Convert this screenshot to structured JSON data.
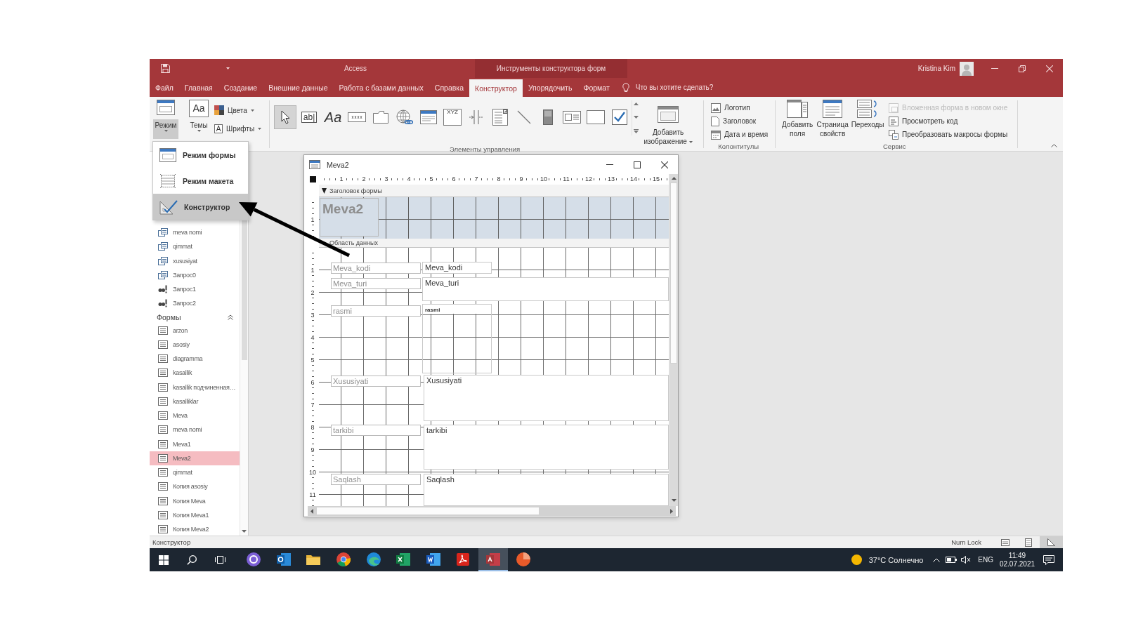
{
  "title_bar": {
    "app_name": "Access",
    "context_title": "Инструменты конструктора форм",
    "user_name": "Kristina Kim"
  },
  "ribbon_tabs": [
    {
      "label": "Файл",
      "selected": false
    },
    {
      "label": "Главная",
      "selected": false
    },
    {
      "label": "Создание",
      "selected": false
    },
    {
      "label": "Внешние данные",
      "selected": false
    },
    {
      "label": "Работа с базами данных",
      "selected": false
    },
    {
      "label": "Справка",
      "selected": false
    },
    {
      "label": "Конструктор",
      "selected": true
    },
    {
      "label": "Упорядочить",
      "selected": false
    },
    {
      "label": "Формат",
      "selected": false
    }
  ],
  "tell_me": {
    "placeholder": "Что вы хотите сделать?"
  },
  "ribbon": {
    "view_button": {
      "label": "Режим",
      "pressed": true
    },
    "themes": {
      "label": "Темы",
      "glyph": "Aa"
    },
    "colors": {
      "label": "Цвета"
    },
    "fonts": {
      "label": "Шрифты",
      "glyph": "A"
    },
    "controls": {
      "label": "Элементы управления",
      "tools": [
        {
          "kind": "pointer",
          "selected": true
        },
        {
          "kind": "text_box",
          "glyph": "ab|",
          "selected": false
        },
        {
          "kind": "label",
          "glyph": "Aa",
          "selected": false
        },
        {
          "kind": "button",
          "selected": false
        },
        {
          "kind": "tab_control",
          "selected": false
        },
        {
          "kind": "hyperlink",
          "selected": false
        },
        {
          "kind": "web_browser",
          "selected": false
        },
        {
          "kind": "option_group",
          "glyph": "XYZ",
          "selected": false
        },
        {
          "kind": "page_break",
          "selected": false
        },
        {
          "kind": "combo_box",
          "selected": false
        },
        {
          "kind": "line",
          "selected": false
        },
        {
          "kind": "toggle",
          "selected": false
        },
        {
          "kind": "list_box",
          "selected": false
        },
        {
          "kind": "rectangle",
          "selected": false
        },
        {
          "kind": "check_box",
          "selected": false
        }
      ],
      "insert_image": "Добавить изображение"
    },
    "header_footer": {
      "label": "Колонтитулы",
      "items": [
        {
          "kind": "logo",
          "label": "Логотип"
        },
        {
          "kind": "title",
          "label": "Заголовок"
        },
        {
          "kind": "date_time",
          "label": "Дата и время"
        }
      ]
    },
    "tools": {
      "label": "Сервис",
      "buttons": [
        {
          "kind": "add_fields",
          "label": "Добавить поля"
        },
        {
          "kind": "property_sheet",
          "label": "Страница свойств"
        },
        {
          "kind": "tab_order",
          "label": "Переходы"
        }
      ],
      "commands": [
        {
          "kind": "subform",
          "label": "Вложенная форма в новом окне",
          "disabled": true
        },
        {
          "kind": "view_code",
          "label": "Просмотреть код",
          "disabled": false
        },
        {
          "kind": "convert_macros",
          "label": "Преобразовать макросы формы",
          "disabled": false
        }
      ]
    }
  },
  "view_menu": {
    "items": [
      {
        "kind": "form_view",
        "label": "Режим формы",
        "selected": false
      },
      {
        "kind": "layout_view",
        "label": "Режим макета",
        "selected": false
      },
      {
        "kind": "design_view",
        "label": "Конструктор",
        "selected": true
      }
    ]
  },
  "navigation": {
    "queries": [
      {
        "kind": "select",
        "label": "meva nomi",
        "selected": false
      },
      {
        "kind": "select",
        "label": "qimmat",
        "selected": false
      },
      {
        "kind": "select",
        "label": "xususiyat",
        "selected": false
      },
      {
        "kind": "select",
        "label": "Запрос0",
        "selected": false
      },
      {
        "kind": "action",
        "label": "Запрос1",
        "selected": false
      },
      {
        "kind": "action",
        "label": "Запрос2",
        "selected": false
      }
    ],
    "forms_group": {
      "title": "Формы",
      "expanded": true,
      "items": [
        {
          "label": "arzon",
          "selected": false
        },
        {
          "label": "asosiy",
          "selected": false
        },
        {
          "label": "diagramma",
          "selected": false
        },
        {
          "label": "kasallik",
          "selected": false
        },
        {
          "label": "kasallik подчиненная…",
          "selected": false
        },
        {
          "label": "kasalliklar",
          "selected": false
        },
        {
          "label": "Meva",
          "selected": false
        },
        {
          "label": "meva nomi",
          "selected": false
        },
        {
          "label": "Meva1",
          "selected": false
        },
        {
          "label": "Meva2",
          "selected": true
        },
        {
          "label": "qimmat",
          "selected": false
        },
        {
          "label": "Копия asosiy",
          "selected": false
        },
        {
          "label": "Копия Meva",
          "selected": false
        },
        {
          "label": "Копия Meva1",
          "selected": false
        },
        {
          "label": "Копия Meva2",
          "selected": false
        }
      ]
    }
  },
  "form_window": {
    "title": "Meva2",
    "ruler": [
      "1",
      "2",
      "3",
      "4",
      "5",
      "6",
      "7",
      "8",
      "9",
      "10",
      "11",
      "12",
      "13",
      "14",
      "15"
    ],
    "header_band": "Заголовок формы",
    "header_ruler": [
      "1"
    ],
    "header_title": "Meva2",
    "detail_band": "Область данных",
    "detail_ruler": [
      "1",
      "2",
      "3",
      "4",
      "5",
      "6",
      "7",
      "8",
      "9",
      "10",
      "11"
    ],
    "fields": [
      {
        "kind": "text",
        "label": "Meva_kodi",
        "control": "Meva_kodi"
      },
      {
        "kind": "text",
        "label": "Meva_turi",
        "control": "Meva_turi"
      },
      {
        "kind": "image",
        "label": "rasmi",
        "control": "rasmi"
      },
      {
        "kind": "memo",
        "label": "Xususiyati",
        "control": "Xususiyati"
      },
      {
        "kind": "memo",
        "label": "tarkibi",
        "control": "tarkibi"
      },
      {
        "kind": "text",
        "label": "Saqlash",
        "control": "Saqlash"
      }
    ]
  },
  "status_bar": {
    "mode": "Конструктор",
    "num_lock": "Num Lock",
    "views": [
      {
        "kind": "form",
        "selected": false
      },
      {
        "kind": "layout",
        "selected": false
      },
      {
        "kind": "design",
        "selected": true
      }
    ]
  },
  "taskbar": {
    "apps": [
      {
        "kind": "messenger",
        "active": false
      },
      {
        "kind": "mail",
        "active": false
      },
      {
        "kind": "files",
        "active": false
      },
      {
        "kind": "browser",
        "active": false
      },
      {
        "kind": "browser_alt",
        "active": false
      },
      {
        "kind": "spreadsheet",
        "active": false
      },
      {
        "kind": "document",
        "active": false
      },
      {
        "kind": "pdf",
        "active": false
      },
      {
        "kind": "database",
        "active": true
      },
      {
        "kind": "presentation",
        "active": false
      }
    ],
    "weather": "37°C Солнечно",
    "language": "ENG",
    "time": "11:49",
    "date": "02.07.2021"
  }
}
